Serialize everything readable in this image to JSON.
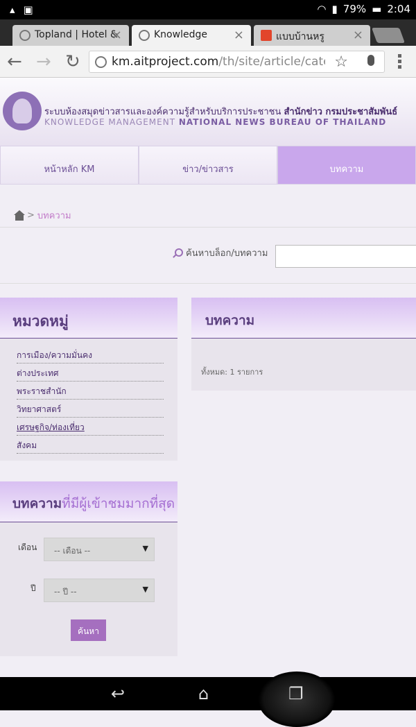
{
  "status_bar": {
    "battery": "79%",
    "time": "2:04"
  },
  "browser": {
    "tabs": [
      {
        "title": "Topland | Hotel &"
      },
      {
        "title": "Knowledge"
      },
      {
        "title": "แบบบ้านหรู"
      }
    ],
    "url_host": "km.aitproject.com",
    "url_path": "/th/site/article/categ"
  },
  "site": {
    "title_thai": "ระบบห้องสมุดข่าวสารและองค์ความรู้สำหรับบริการประชาชน",
    "title_thai_bold": "สำนักข่าว กรมประชาสัมพันธ์",
    "title_en_plain": "KNOWLEDGE MANAGEMENT",
    "title_en_bold": "NATIONAL NEWS BUREAU OF THAILAND"
  },
  "main_nav": [
    {
      "label": "หน้าหลัก KM"
    },
    {
      "label": "ข่าว/ข่าวสาร"
    },
    {
      "label": "บทความ"
    }
  ],
  "breadcrumb": {
    "separator": ">",
    "current": "บทความ"
  },
  "search": {
    "label": "ค้นหาบล็อก/บทความ",
    "value": ""
  },
  "categories": {
    "title": "หมวดหมู่",
    "items": [
      {
        "label": "การเมือง/ความมั่นคง"
      },
      {
        "label": "ต่างประเทศ"
      },
      {
        "label": "พระราชสำนัก"
      },
      {
        "label": "วิทยาศาสตร์"
      },
      {
        "label": "เศรษฐกิจ/ท่องเที่ยว"
      },
      {
        "label": "สังคม"
      }
    ]
  },
  "articles": {
    "title": "บทความ",
    "total": "ทั้งหมด: 1 รายการ"
  },
  "popular": {
    "title_bold": "บทความ",
    "title_rest": "ที่มีผู้เข้าชมมากที่สุด",
    "month_label": "เดือน",
    "month_value": "-- เดือน --",
    "year_label": "ปี",
    "year_value": "-- ปี --",
    "search_button": "ค้นหา"
  },
  "icons": {
    "back": "back-arrow-icon",
    "forward": "forward-arrow-icon",
    "reload": "reload-icon",
    "home": "home-icon",
    "search": "magnifier-icon"
  },
  "colors": {
    "accent": "#c9a7ec",
    "brand_dark": "#5a3e7e",
    "button": "#a56fbf"
  }
}
